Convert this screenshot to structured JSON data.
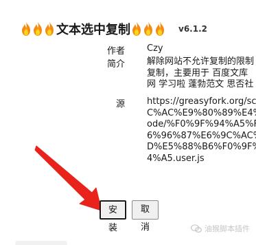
{
  "header": {
    "emoji": "🔥",
    "title": "文本选中复制",
    "version": "v6.1.2"
  },
  "meta": {
    "author_label": "作者",
    "author_value": "Czy",
    "intro_label": "简介",
    "intro_lines": [
      "解除网站不允许复制的限制",
      "复制，主要用于 百度文库",
      "网 学习啦 蓬勃范文 思否社"
    ],
    "source_label": "源",
    "source_lines": [
      "https://greasyfork.org/scr",
      "C%AC%E9%80%89%E4%B",
      "ode/%F0%9F%94%A5%F0%",
      "6%96%87%E6%9C%AC%E",
      "D%E5%88%B6%F0%9F%94",
      "4%A5.user.js"
    ]
  },
  "buttons": {
    "install": "安装",
    "cancel": "取消"
  },
  "watermark": {
    "text": "油猴脚本插件"
  },
  "colors": {
    "arrow": "#e8231b",
    "text": "#1a1a1a",
    "button_bg": "#f0f0f0",
    "watermark": "#c6c6c6"
  }
}
